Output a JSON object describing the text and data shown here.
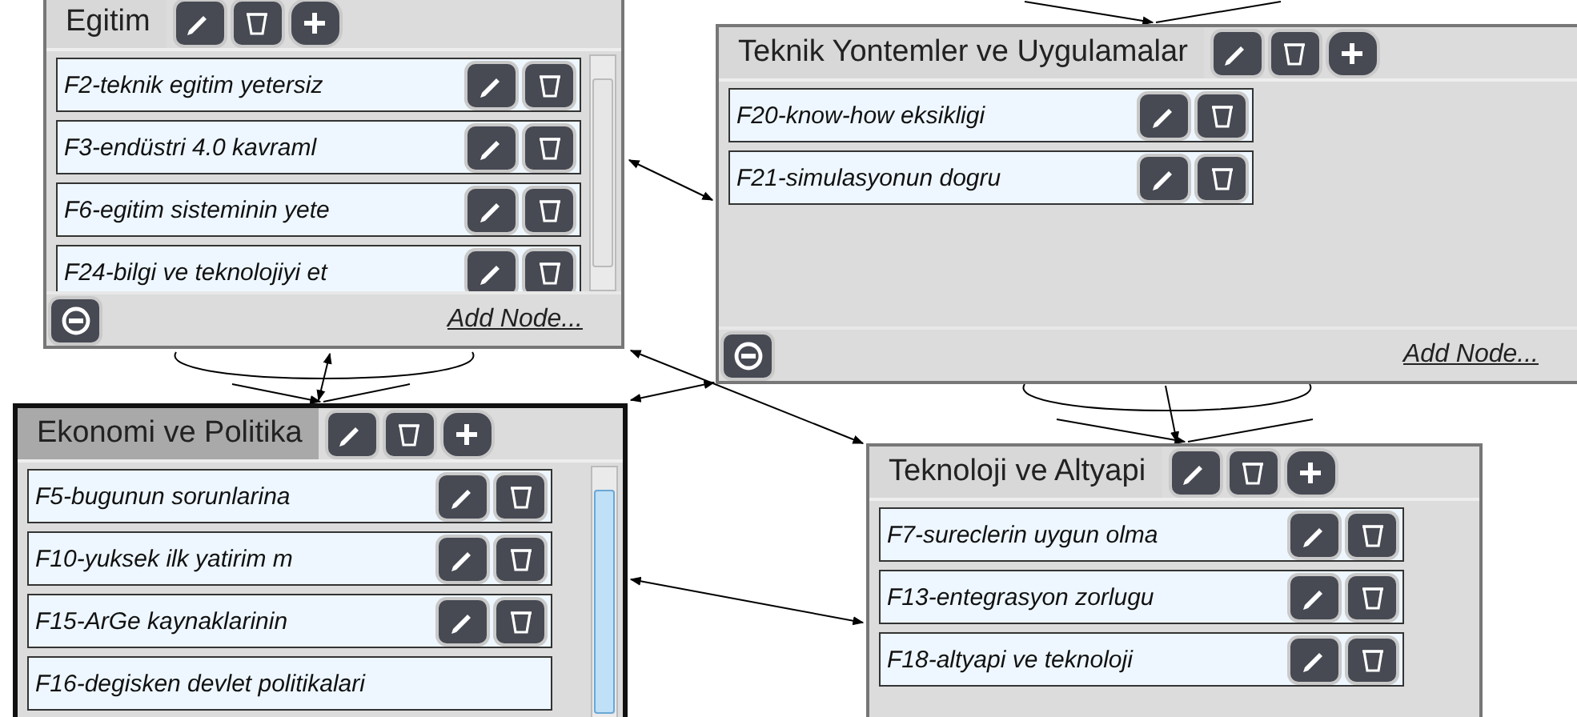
{
  "panels": [
    {
      "title": "Egitim",
      "selected": false,
      "scrollable": true,
      "footer": {
        "add_node_label": "Add Node..."
      },
      "items": [
        {
          "label": "F2-teknik egitim yetersiz",
          "actions_visible": true
        },
        {
          "label": "F3-endüstri 4.0 kavraml",
          "actions_visible": true
        },
        {
          "label": "F6-egitim sisteminin yete",
          "actions_visible": true
        },
        {
          "label": "F24-bilgi ve teknolojiyi et",
          "actions_visible": true
        }
      ]
    },
    {
      "title": "Teknik Yontemler ve Uygulamalar",
      "selected": false,
      "scrollable": false,
      "footer": {
        "add_node_label": "Add Node..."
      },
      "items": [
        {
          "label": "F20-know-how eksikligi",
          "actions_visible": true
        },
        {
          "label": "F21-simulasyonun dogru",
          "actions_visible": true
        }
      ]
    },
    {
      "title": "Ekonomi ve Politika",
      "selected": true,
      "scrollable": true,
      "items": [
        {
          "label": "F5-bugunun sorunlarina",
          "actions_visible": true
        },
        {
          "label": "F10-yuksek ilk yatirim m",
          "actions_visible": true
        },
        {
          "label": "F15-ArGe kaynaklarinin",
          "actions_visible": true
        },
        {
          "label": "F16-degisken devlet politikalari",
          "actions_visible": false
        }
      ]
    },
    {
      "title": "Teknoloji ve Altyapi",
      "selected": false,
      "scrollable": false,
      "items": [
        {
          "label": "F7-sureclerin uygun olma",
          "actions_visible": true
        },
        {
          "label": "F13-entegrasyon zorlugu",
          "actions_visible": true
        },
        {
          "label": "F18-altyapi ve teknoloji",
          "actions_visible": true
        }
      ]
    }
  ]
}
